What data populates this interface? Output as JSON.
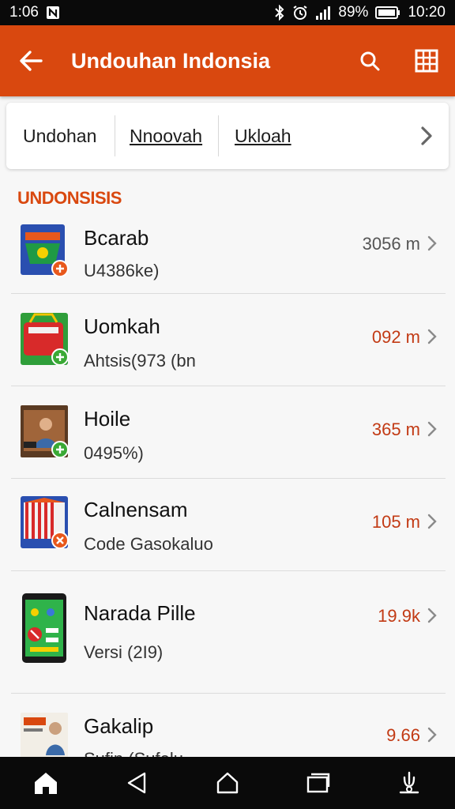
{
  "status_bar": {
    "time_left": "1:06",
    "battery_percent": "89%",
    "time_right": "10:20",
    "icons": [
      "notification-app-icon",
      "bluetooth-icon",
      "alarm-icon",
      "signal-icon",
      "battery-icon"
    ]
  },
  "app_bar": {
    "title": "Undouhan Indonsia",
    "icons": [
      "back-arrow-icon",
      "search-icon",
      "grid-menu-icon"
    ],
    "color": "#d9480f"
  },
  "tabs": {
    "items": [
      "Undohan",
      "Nnoovah",
      "Ukloah"
    ],
    "next_icon": "chevron-right-icon"
  },
  "section": {
    "header": "UNDONSISIS",
    "accent": "#d9480f"
  },
  "items": [
    {
      "title": "Bcarab",
      "subtitle": "U4386ke)",
      "size": "3056 m",
      "size_color": "#555555",
      "thumb_icon": "flag-card-icon",
      "badge_color": "#e8581c"
    },
    {
      "title": "Uomkah",
      "subtitle": "Ahtsis(973 (bn",
      "size": "092 m",
      "size_color": "#c23a14",
      "thumb_icon": "red-box-icon",
      "badge_color": "#3aa935"
    },
    {
      "title": "Hoile",
      "subtitle": "0495%)",
      "size": "365 m",
      "size_color": "#c23a14",
      "thumb_icon": "photo-person-icon",
      "badge_color": "#3aa935"
    },
    {
      "title": "Calnensam",
      "subtitle": "Code Gasokaluo",
      "size": "105 m",
      "size_color": "#c23a14",
      "thumb_icon": "striped-flag-icon",
      "badge_color": "#e8581c"
    },
    {
      "title": "Narada Pille",
      "subtitle": "Versi (2I9)",
      "size": "19.9k",
      "size_color": "#c23a14",
      "thumb_icon": "phone-app-icon",
      "badge_color": "#e8581c"
    },
    {
      "title": "Gakalip",
      "subtitle": "Sufin (Sufelu",
      "size": "9.66",
      "size_color": "#c23a14",
      "thumb_icon": "poster-person-icon",
      "badge_color": "#3aa935"
    }
  ],
  "nav_bar": {
    "icons": [
      "home-icon",
      "back-triangle-icon",
      "home-circle-icon",
      "recents-icon",
      "accessibility-icon"
    ]
  }
}
